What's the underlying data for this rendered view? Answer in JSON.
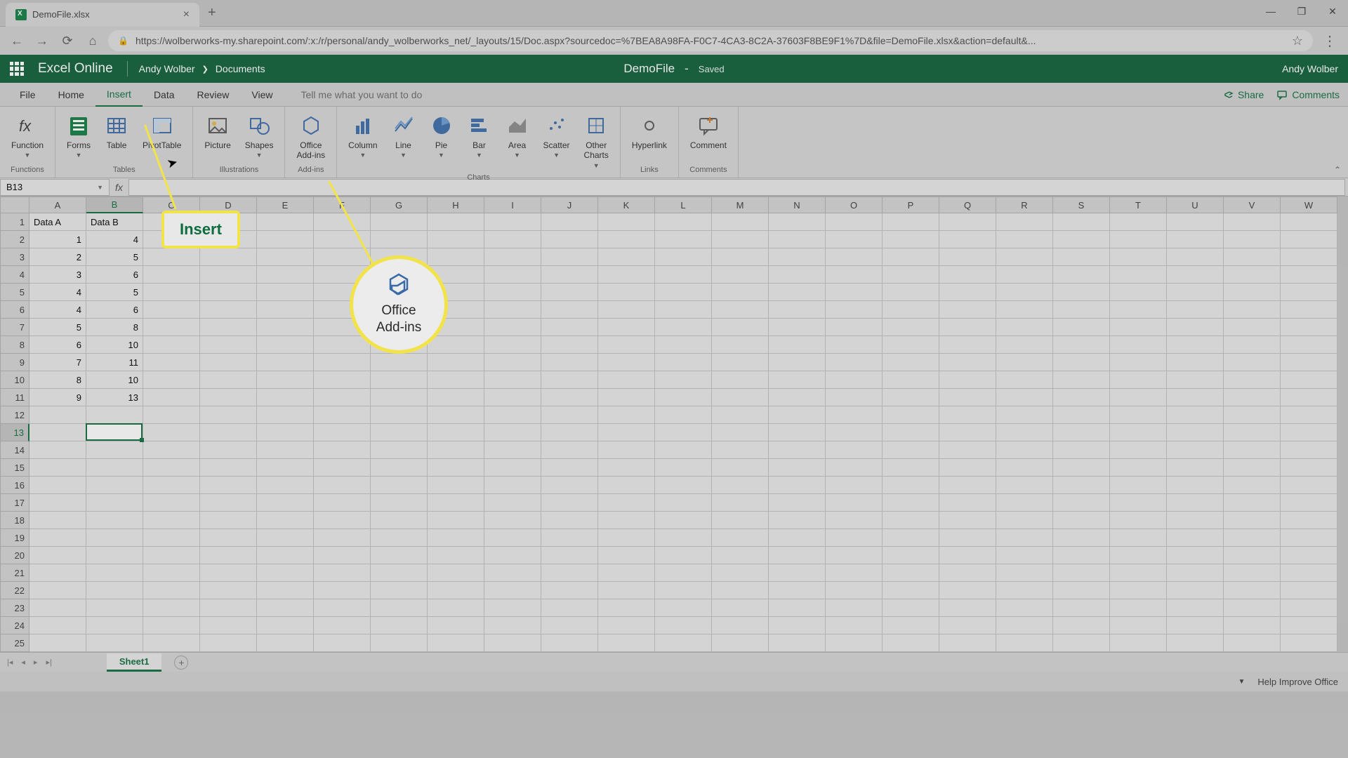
{
  "browser": {
    "tab_title": "DemoFile.xlsx",
    "url": "https://wolberworks-my.sharepoint.com/:x:/r/personal/andy_wolberworks_net/_layouts/15/Doc.aspx?sourcedoc=%7BEA8A98FA-F0C7-4CA3-8C2A-37603F8BE9F1%7D&file=DemoFile.xlsx&action=default&..."
  },
  "header": {
    "app_name": "Excel Online",
    "breadcrumb_user": "Andy Wolber",
    "breadcrumb_loc": "Documents",
    "doc_name": "DemoFile",
    "saved": "Saved",
    "user": "Andy Wolber"
  },
  "menu": {
    "items": [
      "File",
      "Home",
      "Insert",
      "Data",
      "Review",
      "View"
    ],
    "active": "Insert",
    "tell_me": "Tell me what you want to do",
    "share": "Share",
    "comments": "Comments"
  },
  "ribbon": {
    "groups": [
      {
        "label": "Functions",
        "items": [
          {
            "name": "Function",
            "arrow": true
          }
        ]
      },
      {
        "label": "Tables",
        "items": [
          {
            "name": "Forms",
            "arrow": true
          },
          {
            "name": "Table"
          },
          {
            "name": "PivotTable"
          }
        ]
      },
      {
        "label": "Illustrations",
        "items": [
          {
            "name": "Picture"
          },
          {
            "name": "Shapes",
            "arrow": true
          }
        ]
      },
      {
        "label": "Add-ins",
        "items": [
          {
            "name": "Office\nAdd-ins"
          }
        ]
      },
      {
        "label": "Charts",
        "items": [
          {
            "name": "Column",
            "arrow": true
          },
          {
            "name": "Line",
            "arrow": true
          },
          {
            "name": "Pie",
            "arrow": true
          },
          {
            "name": "Bar",
            "arrow": true
          },
          {
            "name": "Area",
            "arrow": true
          },
          {
            "name": "Scatter",
            "arrow": true
          },
          {
            "name": "Other\nCharts",
            "arrow": true
          }
        ]
      },
      {
        "label": "Links",
        "items": [
          {
            "name": "Hyperlink"
          }
        ]
      },
      {
        "label": "Comments",
        "items": [
          {
            "name": "Comment"
          }
        ]
      }
    ]
  },
  "namebox": "B13",
  "columns": [
    "A",
    "B",
    "C",
    "D",
    "E",
    "F",
    "G",
    "H",
    "I",
    "J",
    "K",
    "L",
    "M",
    "N",
    "O",
    "P",
    "Q",
    "R",
    "S",
    "T",
    "U",
    "V",
    "W"
  ],
  "col_widths": {
    "default": 81,
    "A": 81,
    "B": 81
  },
  "rows": 25,
  "sel_col": "B",
  "sel_row": 13,
  "data": {
    "A1": "Data A",
    "B1": "Data B",
    "A2": "1",
    "B2": "4",
    "A3": "2",
    "B3": "5",
    "A4": "3",
    "B4": "6",
    "A5": "4",
    "B5": "5",
    "A6": "4",
    "B6": "6",
    "A7": "5",
    "B7": "8",
    "A8": "6",
    "B8": "10",
    "A9": "7",
    "B9": "11",
    "A10": "8",
    "B10": "10",
    "A11": "9",
    "B11": "13"
  },
  "sheet": {
    "name": "Sheet1"
  },
  "status": {
    "help": "Help Improve Office"
  },
  "annot": {
    "insert": "Insert",
    "addins_l1": "Office",
    "addins_l2": "Add-ins"
  }
}
